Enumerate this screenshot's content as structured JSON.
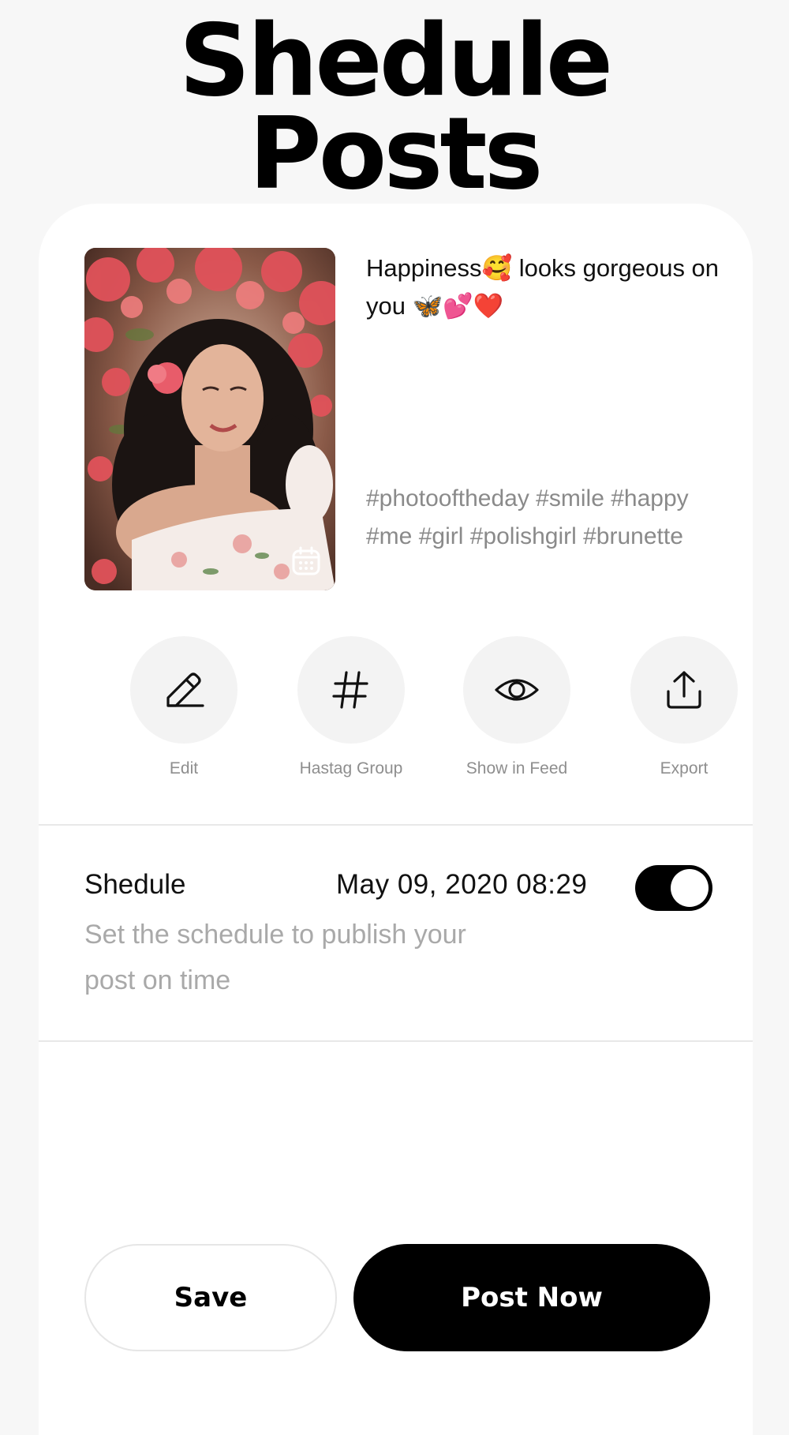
{
  "title": {
    "line1": "Shedule",
    "line2": "Posts"
  },
  "post": {
    "caption": "Happiness🥰 looks gorgeous on you 🦋💕❤️",
    "hashtags": "#photooftheday #smile #happy #me #girl #polishgirl #brunette",
    "image": "portrait-woman-curly-hair-pink-flowers",
    "badge_icon": "calendar-icon"
  },
  "actions": [
    {
      "label": "Edit",
      "icon": "pencil-icon"
    },
    {
      "label": "Hastag Group",
      "icon": "hashtag-icon"
    },
    {
      "label": "Show in Feed",
      "icon": "eye-icon"
    },
    {
      "label": "Export",
      "icon": "share-icon"
    }
  ],
  "schedule": {
    "title": "Shedule",
    "datetime": "May 09, 2020 08:29",
    "description": "Set the schedule to publish your post on time",
    "enabled": true
  },
  "buttons": {
    "save": "Save",
    "post_now": "Post Now"
  },
  "colors": {
    "background": "#f7f7f7",
    "card": "#ffffff",
    "primary": "#000000",
    "muted_text": "#8e8e8e",
    "action_circle": "#f3f3f3"
  }
}
